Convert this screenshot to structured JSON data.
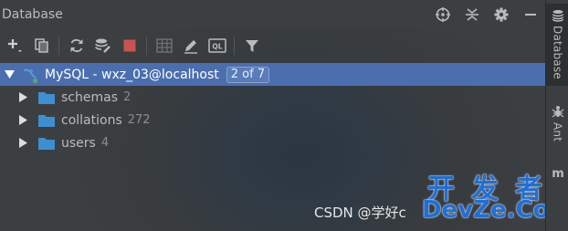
{
  "window": {
    "title": "Database"
  },
  "colors": {
    "selection": "#4b6eaf",
    "folder": "#3d8fd1",
    "stop": "#c75450",
    "watermark": "#1f6fd8"
  },
  "title_actions": [
    {
      "icon": "target-icon"
    },
    {
      "icon": "collapse-all-icon"
    },
    {
      "icon": "gear-icon"
    },
    {
      "icon": "minimize-icon"
    }
  ],
  "toolbar": [
    {
      "icon": "add-icon"
    },
    {
      "icon": "copy-icon"
    },
    {
      "icon": "refresh-icon"
    },
    {
      "icon": "data-source-properties-icon"
    },
    {
      "icon": "stop-icon"
    },
    {
      "icon": "table-icon"
    },
    {
      "icon": "edit-icon"
    },
    {
      "icon": "sql-console-icon",
      "text": "QL"
    },
    {
      "icon": "filter-icon"
    }
  ],
  "tree": {
    "connection": {
      "label": "MySQL - wxz_03@localhost",
      "badge": "2 of 7"
    },
    "children": [
      {
        "label": "schemas",
        "count": "2"
      },
      {
        "label": "collations",
        "count": "272"
      },
      {
        "label": "users",
        "count": "4"
      }
    ]
  },
  "sidebar": {
    "tabs": [
      {
        "label": "Database",
        "icon": "database-icon"
      },
      {
        "label": "Ant",
        "icon": "ant-icon"
      },
      {
        "label": "m",
        "icon": "maven-icon"
      }
    ]
  },
  "watermark": {
    "csdn": "CSDN @学好c",
    "cn": "开发者",
    "en": "DevZe.CoM"
  }
}
